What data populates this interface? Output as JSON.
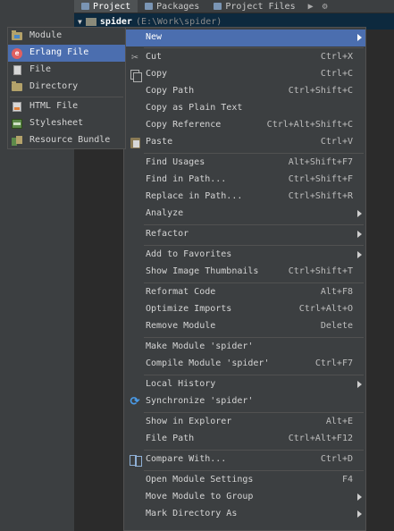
{
  "toolwindow": {
    "tabs": [
      {
        "label": "Project"
      },
      {
        "label": "Packages"
      },
      {
        "label": "Project Files"
      }
    ],
    "project_name": "spider",
    "project_path": "(E:\\Work\\spider)"
  },
  "new_submenu": {
    "items": [
      {
        "label": "Module",
        "icon": "module-folder-icon"
      },
      {
        "label": "Erlang File",
        "icon": "erlang-file-icon"
      },
      {
        "label": "File",
        "icon": "file-icon"
      },
      {
        "label": "Directory",
        "icon": "folder-icon"
      },
      {
        "label": "HTML File",
        "icon": "html-file-icon"
      },
      {
        "label": "Stylesheet",
        "icon": "stylesheet-icon"
      },
      {
        "label": "Resource Bundle",
        "icon": "resource-bundle-icon"
      }
    ]
  },
  "context_menu": {
    "items": [
      {
        "label": "New",
        "shortcut": ""
      },
      {
        "label": "Cut",
        "shortcut": "Ctrl+X"
      },
      {
        "label": "Copy",
        "shortcut": "Ctrl+C"
      },
      {
        "label": "Copy Path",
        "shortcut": "Ctrl+Shift+C"
      },
      {
        "label": "Copy as Plain Text",
        "shortcut": ""
      },
      {
        "label": "Copy Reference",
        "shortcut": "Ctrl+Alt+Shift+C"
      },
      {
        "label": "Paste",
        "shortcut": "Ctrl+V"
      },
      {
        "label": "Find Usages",
        "shortcut": "Alt+Shift+F7"
      },
      {
        "label": "Find in Path...",
        "shortcut": "Ctrl+Shift+F"
      },
      {
        "label": "Replace in Path...",
        "shortcut": "Ctrl+Shift+R"
      },
      {
        "label": "Analyze",
        "shortcut": ""
      },
      {
        "label": "Refactor",
        "shortcut": ""
      },
      {
        "label": "Add to Favorites",
        "shortcut": ""
      },
      {
        "label": "Show Image Thumbnails",
        "shortcut": "Ctrl+Shift+T"
      },
      {
        "label": "Reformat Code",
        "shortcut": "Alt+F8"
      },
      {
        "label": "Optimize Imports",
        "shortcut": "Ctrl+Alt+O"
      },
      {
        "label": "Remove Module",
        "shortcut": "Delete"
      },
      {
        "label": "Make Module 'spider'",
        "shortcut": ""
      },
      {
        "label": "Compile Module 'spider'",
        "shortcut": "Ctrl+F7"
      },
      {
        "label": "Local History",
        "shortcut": ""
      },
      {
        "label": "Synchronize 'spider'",
        "shortcut": ""
      },
      {
        "label": "Show in Explorer",
        "shortcut": "Alt+E"
      },
      {
        "label": "File Path",
        "shortcut": "Ctrl+Alt+F12"
      },
      {
        "label": "Compare With...",
        "shortcut": "Ctrl+D"
      },
      {
        "label": "Open Module Settings",
        "shortcut": "F4"
      },
      {
        "label": "Move Module to Group",
        "shortcut": ""
      },
      {
        "label": "Mark Directory As",
        "shortcut": ""
      }
    ]
  },
  "colors": {
    "menu_bg": "#3c3f41",
    "highlight": "#4b6eaf",
    "separator": "#515151",
    "text": "#d4d4d4"
  }
}
